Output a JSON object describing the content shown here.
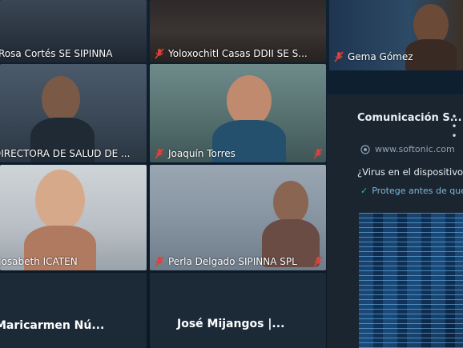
{
  "participants": {
    "p1": {
      "name": "Rosa Cortés SE SIPINNA",
      "muted": false
    },
    "p2": {
      "name": "Yoloxochitl Casas DDII SE S...",
      "muted": true
    },
    "p3": {
      "name": "Gema Gómez",
      "muted": true
    },
    "p4": {
      "name": "DIRECTORA DE SALUD DE ...",
      "muted": false
    },
    "p5": {
      "name": "Joaquín Torres",
      "muted": true
    },
    "p6": {
      "name": "Josabeth ICATEN",
      "muted": false
    },
    "p7": {
      "name": "Perla Delgado SIPINNA SPL",
      "muted": true
    }
  },
  "audio_only": {
    "a1": "Maricarmen  Nú...",
    "a2": "José  Mijangos  |..."
  },
  "ad": {
    "title": "Comunicación  S...",
    "domain": "www.softonic.com",
    "headline": "¿Virus en el dispositivo...",
    "protect_text": "Protege antes de que..."
  },
  "colors": {
    "muted_red": "#e0403a",
    "panel": "#1a2530",
    "accent_link": "#7fb6d9"
  }
}
